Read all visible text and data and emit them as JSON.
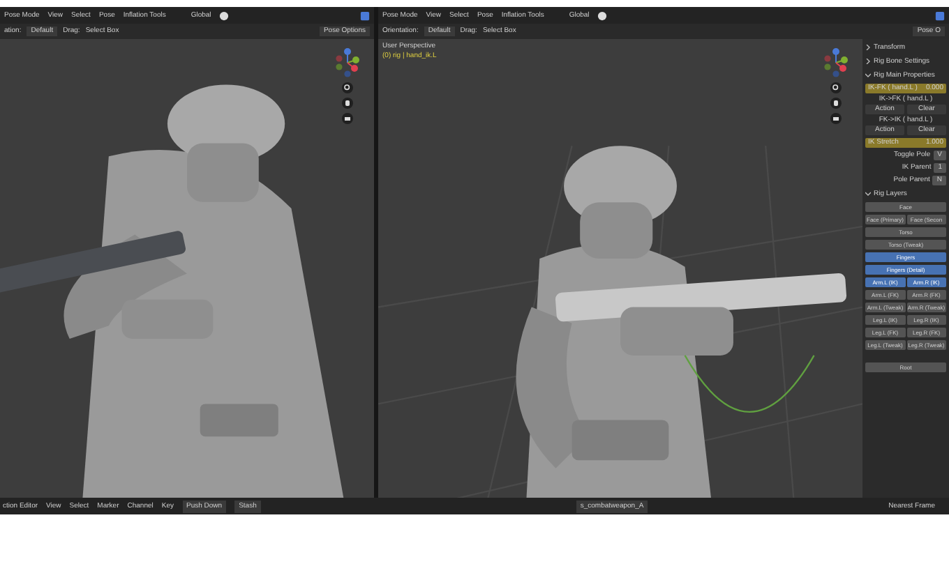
{
  "left_viewport": {
    "header": {
      "mode": "Pose Mode",
      "menus": [
        "View",
        "Select",
        "Pose",
        "Inflation Tools"
      ],
      "orientation": "Global"
    },
    "toolbar": {
      "orientation_label": "ation:",
      "orientation_value": "Default",
      "drag_label": "Drag:",
      "drag_value": "Select Box",
      "options": "Pose Options"
    }
  },
  "right_viewport": {
    "header": {
      "mode": "Pose Mode",
      "menus": [
        "View",
        "Select",
        "Pose",
        "Inflation Tools"
      ],
      "orientation": "Global"
    },
    "toolbar": {
      "orientation_label": "Orientation:",
      "orientation_value": "Default",
      "drag_label": "Drag:",
      "drag_value": "Select Box",
      "options": "Pose O"
    },
    "overlay": {
      "view_name": "User Perspective",
      "object": "(0) rig | hand_ik.L"
    }
  },
  "n_panel": {
    "rows": [
      {
        "kind": "header",
        "label": "Transform",
        "expanded": false
      },
      {
        "kind": "header",
        "label": "Rig Bone Settings",
        "expanded": false
      },
      {
        "kind": "header",
        "label": "Rig Main Properties",
        "expanded": true
      },
      {
        "kind": "slider",
        "label": "IK-FK ( hand.L )",
        "value": "0.000",
        "animated": true
      },
      {
        "kind": "snap",
        "label": "IK->FK ( hand.L )",
        "buttons": [
          "Action",
          "Clear"
        ]
      },
      {
        "kind": "snap",
        "label": "FK->IK ( hand.L )",
        "buttons": [
          "Action",
          "Clear"
        ]
      },
      {
        "kind": "slider",
        "label": "IK Stretch",
        "value": "1.000",
        "animated": true
      },
      {
        "kind": "toggle",
        "label": "Toggle Pole",
        "value": "V"
      },
      {
        "kind": "toggle",
        "label": "IK Parent",
        "value": "1"
      },
      {
        "kind": "toggle",
        "label": "Pole Parent",
        "value": "N"
      },
      {
        "kind": "header",
        "label": "Rig Layers",
        "expanded": true
      },
      {
        "kind": "layer",
        "buttons": [
          {
            "label": "Face",
            "selected": false
          }
        ]
      },
      {
        "kind": "layer",
        "buttons": [
          {
            "label": "Face (Primary)",
            "selected": false
          },
          {
            "label": "Face (Secon",
            "selected": false
          }
        ]
      },
      {
        "kind": "layer",
        "buttons": [
          {
            "label": "Torso",
            "selected": false
          }
        ]
      },
      {
        "kind": "layer",
        "buttons": [
          {
            "label": "Torso (Tweak)",
            "selected": false
          }
        ]
      },
      {
        "kind": "layer",
        "buttons": [
          {
            "label": "Fingers",
            "selected": true
          }
        ]
      },
      {
        "kind": "layer",
        "buttons": [
          {
            "label": "Fingers (Detail)",
            "selected": true
          }
        ]
      },
      {
        "kind": "layer",
        "buttons": [
          {
            "label": "Arm.L (IK)",
            "selected": true
          },
          {
            "label": "Arm.R (IK)",
            "selected": true
          }
        ]
      },
      {
        "kind": "layer",
        "buttons": [
          {
            "label": "Arm.L (FK)",
            "selected": false
          },
          {
            "label": "Arm.R (FK)",
            "selected": false
          }
        ]
      },
      {
        "kind": "layer",
        "buttons": [
          {
            "label": "Arm.L (Tweak)",
            "selected": false
          },
          {
            "label": "Arm.R (Tweak)",
            "selected": false
          }
        ]
      },
      {
        "kind": "layer",
        "buttons": [
          {
            "label": "Leg.L (IK)",
            "selected": false
          },
          {
            "label": "Leg.R (IK)",
            "selected": false
          }
        ]
      },
      {
        "kind": "layer",
        "buttons": [
          {
            "label": "Leg.L (FK)",
            "selected": false
          },
          {
            "label": "Leg.R (FK)",
            "selected": false
          }
        ]
      },
      {
        "kind": "layer",
        "buttons": [
          {
            "label": "Leg.L (Tweak)",
            "selected": false
          },
          {
            "label": "Leg.R (Tweak)",
            "selected": false
          }
        ]
      },
      {
        "kind": "gap"
      },
      {
        "kind": "layer",
        "buttons": [
          {
            "label": "Root",
            "selected": false
          }
        ]
      }
    ]
  },
  "bottom_bar": {
    "editor": "ction Editor",
    "menus": [
      "View",
      "Select",
      "Marker",
      "Channel",
      "Key"
    ],
    "push_down": "Push Down",
    "stash": "Stash",
    "action": "s_combatweapon_A",
    "snap": "Nearest Frame"
  }
}
